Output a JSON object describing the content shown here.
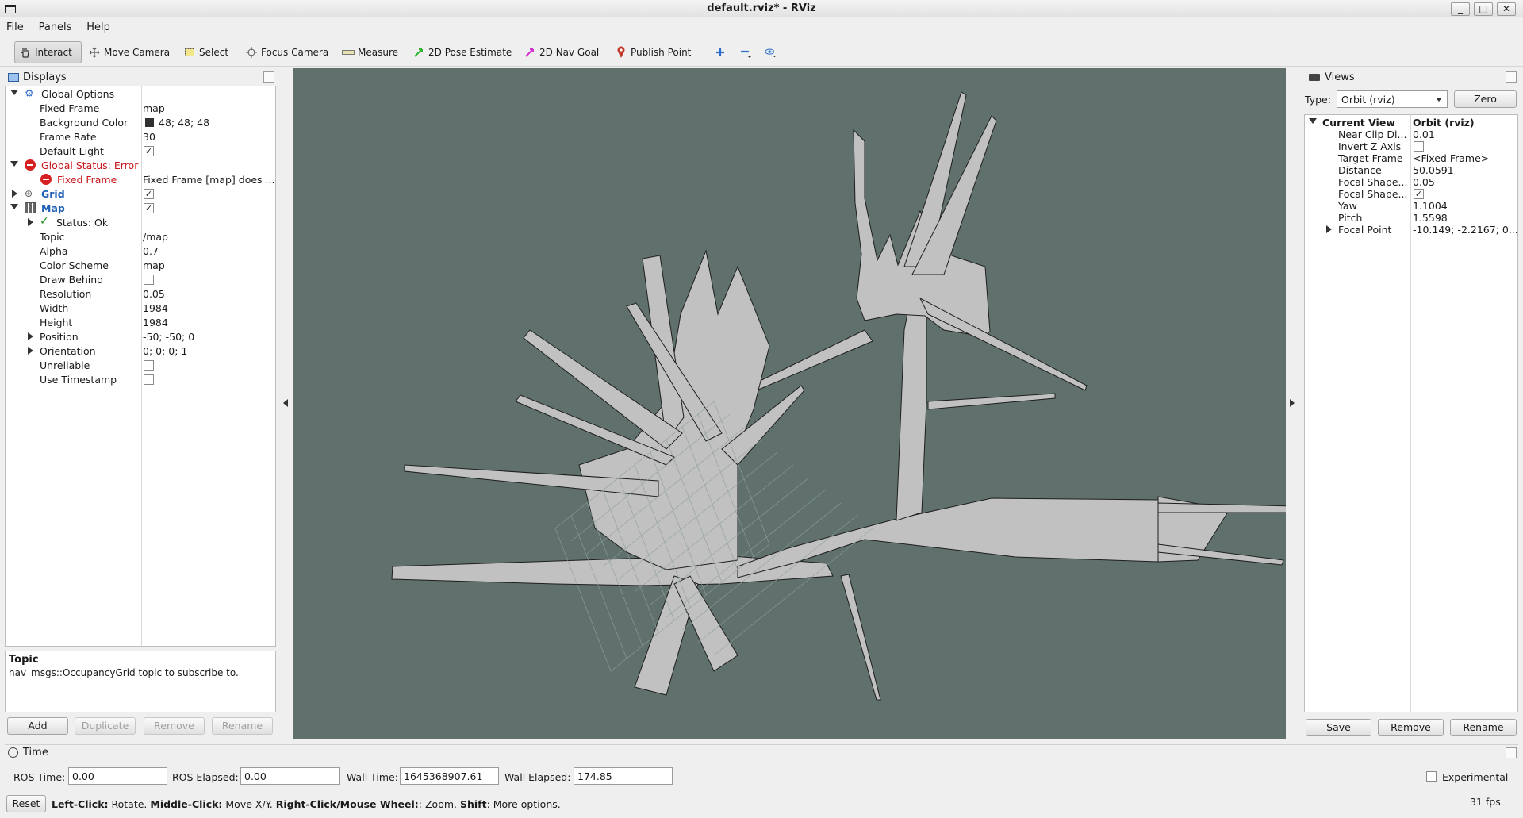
{
  "window": {
    "title": "default.rviz* - RViz"
  },
  "menu": [
    "File",
    "Panels",
    "Help"
  ],
  "toolbar": {
    "interact": "Interact",
    "move_camera": "Move Camera",
    "select": "Select",
    "focus_camera": "Focus Camera",
    "measure": "Measure",
    "pose_estimate": "2D Pose Estimate",
    "nav_goal": "2D Nav Goal",
    "publish_point": "Publish Point"
  },
  "displays": {
    "title": "Displays",
    "global_options": "Global Options",
    "fixed_frame_label": "Fixed Frame",
    "fixed_frame_value": "map",
    "bg_color_label": "Background Color",
    "bg_color_value": "48; 48; 48",
    "bg_color_swatch": "#303030",
    "frame_rate_label": "Frame Rate",
    "frame_rate_value": "30",
    "default_light_label": "Default Light",
    "global_status": "Global Status: Error",
    "fixed_frame_error_label": "Fixed Frame",
    "fixed_frame_error_value": "Fixed Frame [map] does ...",
    "grid_label": "Grid",
    "map_label": "Map",
    "status_ok": "Status: Ok",
    "topic_label": "Topic",
    "topic_value": "/map",
    "alpha_label": "Alpha",
    "alpha_value": "0.7",
    "color_scheme_label": "Color Scheme",
    "color_scheme_value": "map",
    "draw_behind_label": "Draw Behind",
    "resolution_label": "Resolution",
    "resolution_value": "0.05",
    "width_label": "Width",
    "width_value": "1984",
    "height_label": "Height",
    "height_value": "1984",
    "position_label": "Position",
    "position_value": "-50; -50; 0",
    "orientation_label": "Orientation",
    "orientation_value": "0; 0; 0; 1",
    "unreliable_label": "Unreliable",
    "use_timestamp_label": "Use Timestamp",
    "desc_title": "Topic",
    "desc_text": "nav_msgs::OccupancyGrid topic to subscribe to.",
    "add": "Add",
    "duplicate": "Duplicate",
    "remove": "Remove",
    "rename": "Rename"
  },
  "views": {
    "title": "Views",
    "type_label": "Type:",
    "type_value": "Orbit (rviz)",
    "zero": "Zero",
    "current_view": "Current View",
    "current_view_value": "Orbit (rviz)",
    "near_clip_label": "Near Clip Di...",
    "near_clip_value": "0.01",
    "invert_z_label": "Invert Z Axis",
    "target_frame_label": "Target Frame",
    "target_frame_value": "<Fixed Frame>",
    "distance_label": "Distance",
    "distance_value": "50.0591",
    "focal_shape1_label": "Focal Shape...",
    "focal_shape1_value": "0.05",
    "focal_shape2_label": "Focal Shape...",
    "yaw_label": "Yaw",
    "yaw_value": "1.1004",
    "pitch_label": "Pitch",
    "pitch_value": "1.5598",
    "focal_point_label": "Focal Point",
    "focal_point_value": "-10.149; -2.2167; 0...",
    "save": "Save",
    "remove": "Remove",
    "rename": "Rename"
  },
  "time": {
    "title": "Time",
    "ros_time_label": "ROS Time:",
    "ros_time_value": "0.00",
    "ros_elapsed_label": "ROS Elapsed:",
    "ros_elapsed_value": "0.00",
    "wall_time_label": "Wall Time:",
    "wall_time_value": "1645368907.61",
    "wall_elapsed_label": "Wall Elapsed:",
    "wall_elapsed_value": "174.85",
    "experimental": "Experimental"
  },
  "statusbar": {
    "reset": "Reset",
    "left_click": "Left-Click:",
    "left_click_desc": " Rotate. ",
    "middle_click": "Middle-Click:",
    "middle_click_desc": " Move X/Y. ",
    "right_click": "Right-Click/Mouse Wheel:",
    "right_click_desc": ": Zoom. ",
    "shift": "Shift",
    "shift_desc": ": More options.",
    "fps": "31 fps"
  },
  "colors": {
    "viewport_bg": "#5f706d",
    "map_free": "#c0c0c0",
    "error_red": "#c8161b",
    "link_blue": "#1e5fb4"
  }
}
